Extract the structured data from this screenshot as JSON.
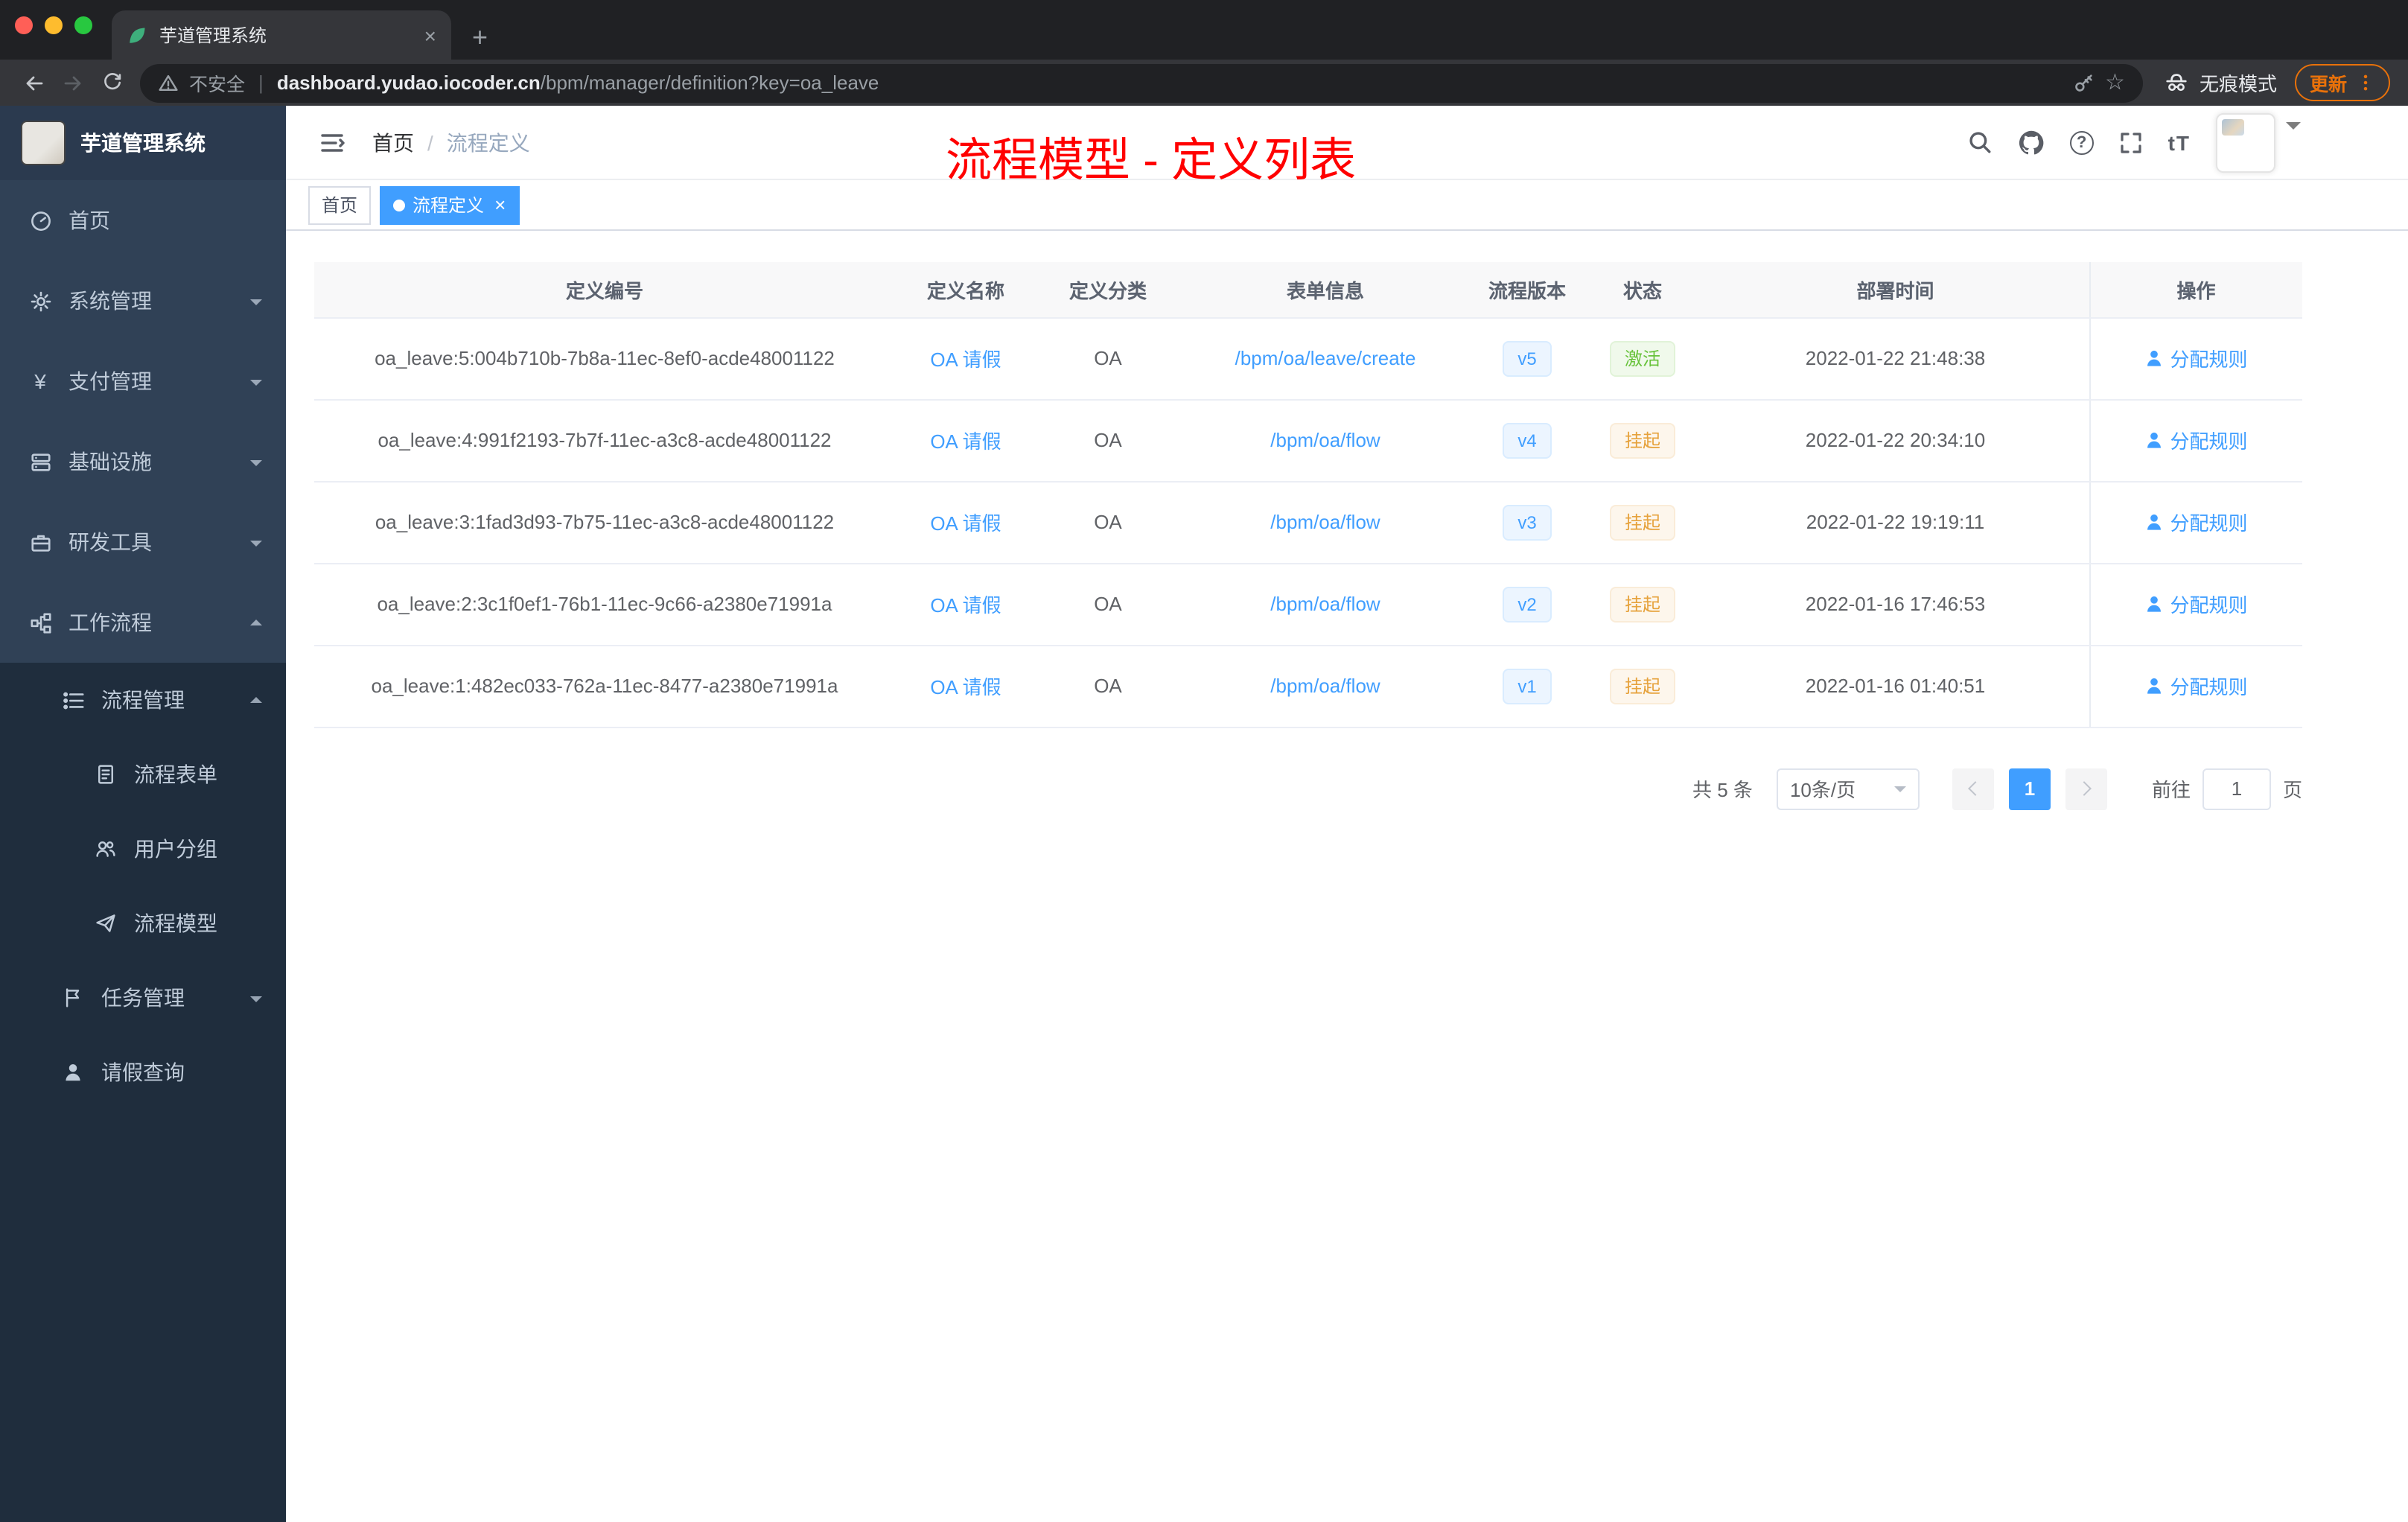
{
  "browser": {
    "tab_title": "芋道管理系统",
    "security_label": "不安全",
    "url_host": "dashboard.yudao.iocoder.cn",
    "url_path": "/bpm/manager/definition?key=oa_leave",
    "incognito_label": "无痕模式",
    "update_label": "更新"
  },
  "colors": {
    "accent": "#409eff",
    "success": "#67c23a",
    "warning": "#e6a23c",
    "annotation": "#ff0000",
    "update": "#e8710a",
    "sidebar": "#304156",
    "submenu": "#1f2d3d"
  },
  "sidebar": {
    "logo_title": "芋道管理系统",
    "items": [
      {
        "label": "首页"
      },
      {
        "label": "系统管理"
      },
      {
        "label": "支付管理"
      },
      {
        "label": "基础设施"
      },
      {
        "label": "研发工具"
      },
      {
        "label": "工作流程"
      },
      {
        "label": "流程管理"
      },
      {
        "label": "流程表单"
      },
      {
        "label": "用户分组"
      },
      {
        "label": "流程模型"
      },
      {
        "label": "任务管理"
      },
      {
        "label": "请假查询"
      }
    ]
  },
  "navbar": {
    "breadcrumb_home": "首页",
    "breadcrumb_sep": "/",
    "breadcrumb_current": "流程定义",
    "font_icon_label": "tT"
  },
  "annotation": "流程模型 - 定义列表",
  "tags": {
    "home": "首页",
    "active": "流程定义"
  },
  "table": {
    "columns": [
      "定义编号",
      "定义名称",
      "定义分类",
      "表单信息",
      "流程版本",
      "状态",
      "部署时间",
      "操作"
    ],
    "rows": [
      {
        "id": "oa_leave:5:004b710b-7b8a-11ec-8ef0-acde48001122",
        "name": "OA 请假",
        "category": "OA",
        "form": "/bpm/oa/leave/create",
        "version": "v5",
        "status": "激活",
        "status_type": "success",
        "time": "2022-01-22 21:48:38",
        "action": "分配规则"
      },
      {
        "id": "oa_leave:4:991f2193-7b7f-11ec-a3c8-acde48001122",
        "name": "OA 请假",
        "category": "OA",
        "form": "/bpm/oa/flow",
        "version": "v4",
        "status": "挂起",
        "status_type": "warning",
        "time": "2022-01-22 20:34:10",
        "action": "分配规则"
      },
      {
        "id": "oa_leave:3:1fad3d93-7b75-11ec-a3c8-acde48001122",
        "name": "OA 请假",
        "category": "OA",
        "form": "/bpm/oa/flow",
        "version": "v3",
        "status": "挂起",
        "status_type": "warning",
        "time": "2022-01-22 19:19:11",
        "action": "分配规则"
      },
      {
        "id": "oa_leave:2:3c1f0ef1-76b1-11ec-9c66-a2380e71991a",
        "name": "OA 请假",
        "category": "OA",
        "form": "/bpm/oa/flow",
        "version": "v2",
        "status": "挂起",
        "status_type": "warning",
        "time": "2022-01-16 17:46:53",
        "action": "分配规则"
      },
      {
        "id": "oa_leave:1:482ec033-762a-11ec-8477-a2380e71991a",
        "name": "OA 请假",
        "category": "OA",
        "form": "/bpm/oa/flow",
        "version": "v1",
        "status": "挂起",
        "status_type": "warning",
        "time": "2022-01-16 01:40:51",
        "action": "分配规则"
      }
    ]
  },
  "pagination": {
    "total": "共 5 条",
    "page_size": "10条/页",
    "page": "1",
    "goto_prefix": "前往",
    "goto_value": "1",
    "goto_suffix": "页"
  }
}
